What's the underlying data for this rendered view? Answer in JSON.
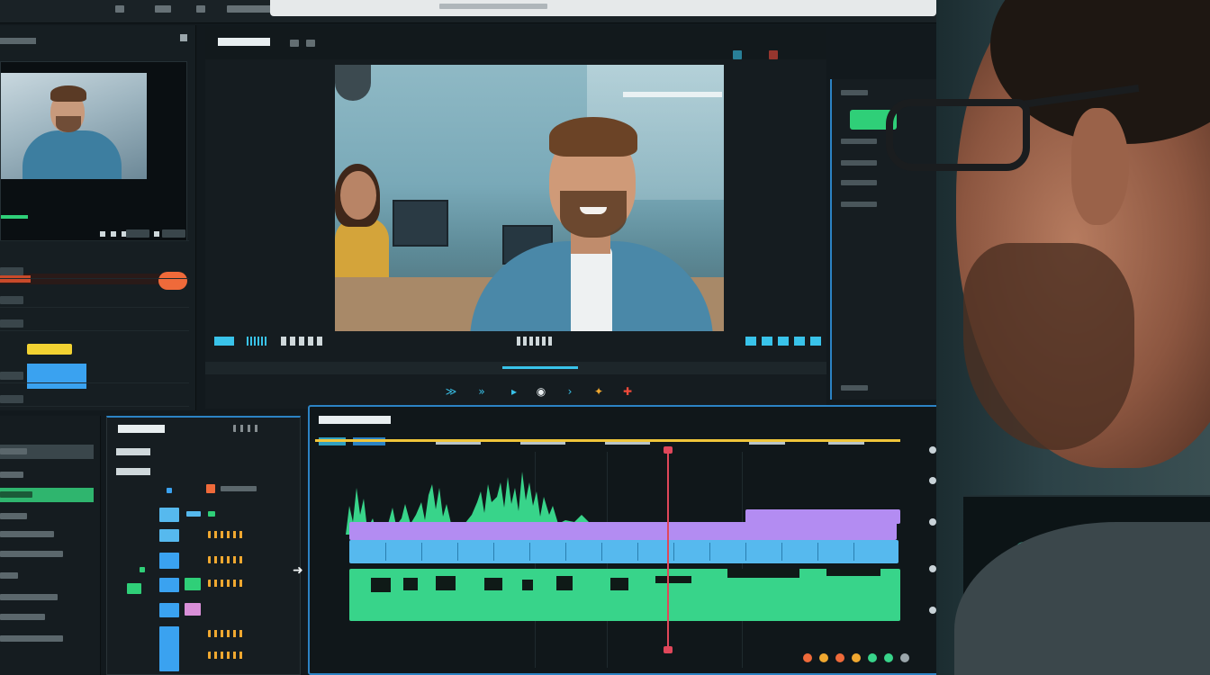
{
  "colors": {
    "accent_blue": "#2c83c4",
    "cyan": "#39c3ea",
    "audio_green": "#38d48a",
    "clip_purple": "#b38cf2",
    "clip_blue": "#56b9ee",
    "marker_yellow": "#f0c53a",
    "playhead_red": "#e0475a",
    "orange": "#ef6a3a"
  },
  "icons": {
    "transport": [
      "skip-back-icon",
      "step-back-icon",
      "play-icon",
      "record-icon",
      "step-forward-icon",
      "marker-icon",
      "flag-icon"
    ],
    "timeline_cursor": "arrow-right-icon"
  }
}
